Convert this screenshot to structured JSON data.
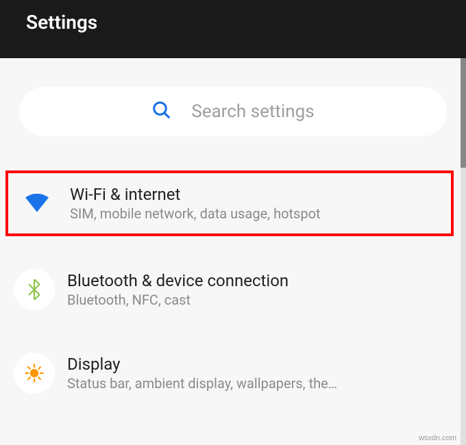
{
  "header": {
    "title": "Settings"
  },
  "search": {
    "placeholder": "Search settings"
  },
  "items": [
    {
      "title": "Wi-Fi & internet",
      "subtitle": "SIM, mobile network, data usage, hotspot",
      "highlighted": true
    },
    {
      "title": "Bluetooth & device connection",
      "subtitle": "Bluetooth, NFC, cast",
      "highlighted": false
    },
    {
      "title": "Display",
      "subtitle": "Status bar, ambient display, wallpapers, the…",
      "highlighted": false
    }
  ],
  "watermark": "wsxdn.com"
}
